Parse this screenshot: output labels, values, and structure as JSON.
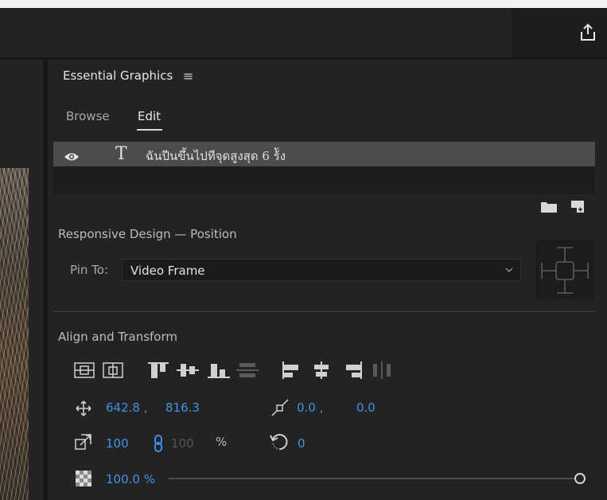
{
  "panel": {
    "title": "Essential Graphics",
    "menu_glyph": "≡",
    "tabs": [
      {
        "label": "Browse",
        "active": false
      },
      {
        "label": "Edit",
        "active": true
      }
    ]
  },
  "layer": {
    "visible": true,
    "type_glyph": "T",
    "name": "ฉันปีนขึ้นไปทีจุดสูงสุด 6 ร้ัง"
  },
  "responsive": {
    "section_title": "Responsive Design — Position",
    "pin_label": "Pin To:",
    "pin_value": "Video Frame"
  },
  "align": {
    "section_title": "Align and Transform",
    "position_x": "642.8 ,",
    "position_y": "816.3",
    "anchor_x": "0.0 ,",
    "anchor_y": "0.0",
    "scale": "100",
    "scale_linked": "100",
    "scale_unit": "%",
    "rotation": "0",
    "opacity": "100.0 %",
    "opacity_fraction": 1.0
  },
  "colors": {
    "accent": "#3b8fe8",
    "panel_bg": "#232323",
    "selected_row": "#4c4c4c"
  },
  "icons": {
    "share": "share-icon",
    "eye": "eye-icon",
    "folder": "folder-icon",
    "new_layer": "new-layer-icon",
    "position": "move-icon",
    "anchor": "anchor-point-icon",
    "scale": "scale-icon",
    "link": "link-icon",
    "rotation": "rotation-icon",
    "opacity": "opacity-icon"
  }
}
